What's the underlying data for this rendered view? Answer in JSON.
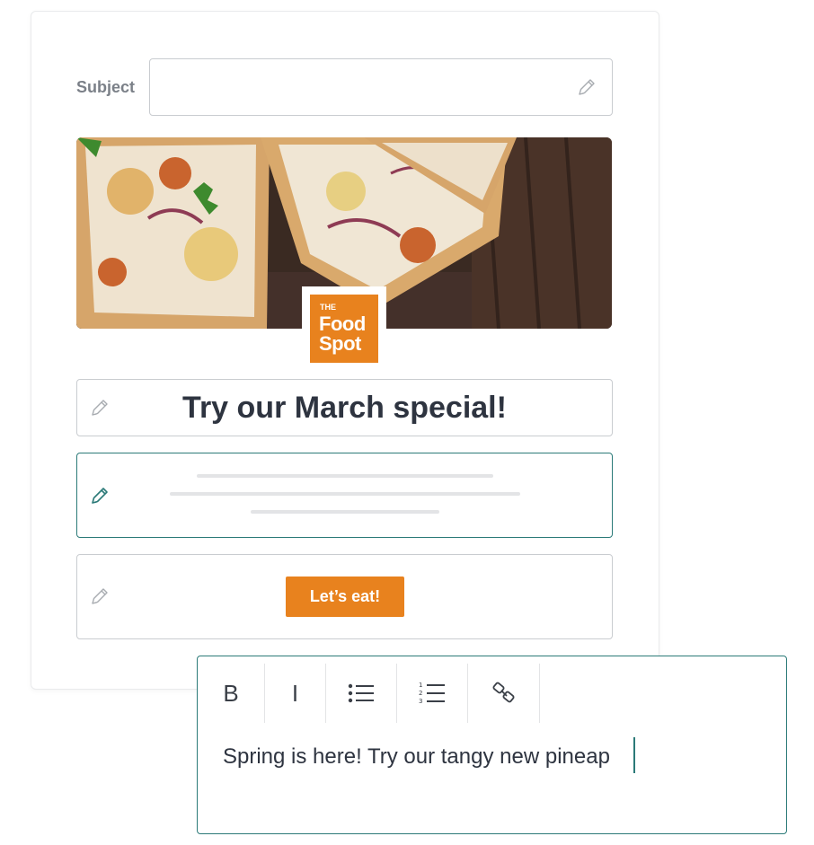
{
  "subject": {
    "label": "Subject",
    "value": "",
    "edit_icon": "pencil-icon"
  },
  "hero": {
    "image": "pizza-photo",
    "logo": {
      "line0": "THE",
      "line1": "Food",
      "line2": "Spot",
      "color": "#e8821e"
    }
  },
  "headline": {
    "text": "Try our March special!",
    "edit_icon": "pencil-icon"
  },
  "body_block": {
    "edit_icon": "pencil-icon",
    "state": "active"
  },
  "cta_block": {
    "button_label": "Let’s eat!",
    "edit_icon": "pencil-icon",
    "color": "#e8821e"
  },
  "editor": {
    "toolbar": {
      "bold_label": "B",
      "italic_label": "I",
      "bullet_icon": "bulleted-list-icon",
      "numbered_icon": "numbered-list-icon",
      "numbered_digits": [
        "1",
        "2",
        "3"
      ],
      "link_icon": "link-icon"
    },
    "text": "Spring is here! Try our tangy new pineap",
    "accent_color": "#2b7a78"
  }
}
